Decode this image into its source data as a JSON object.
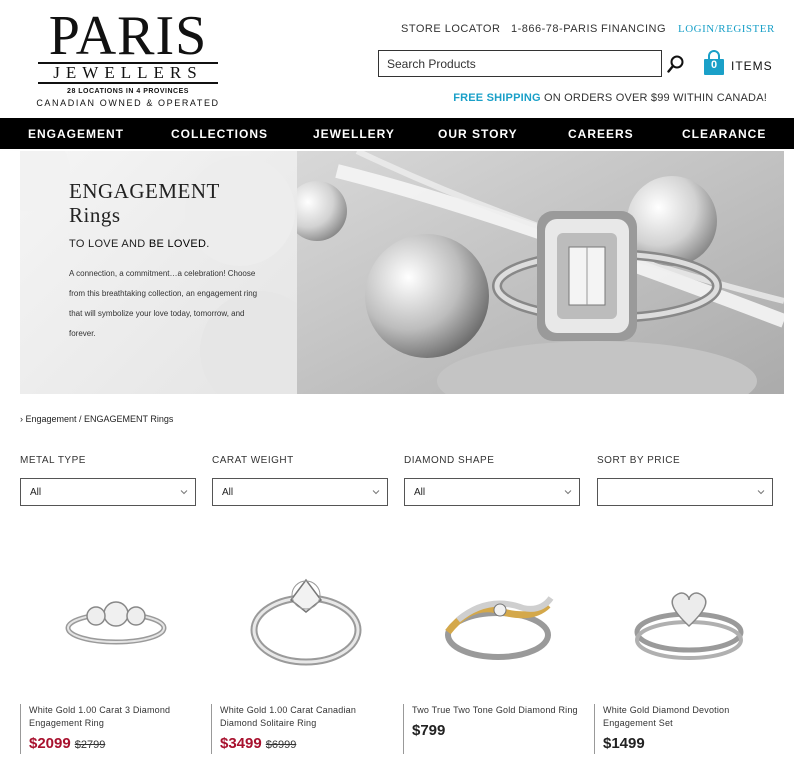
{
  "brand": {
    "name": "PARIS",
    "sub": "JEWELLERS",
    "locations": "28 LOCATIONS IN 4 PROVINCES",
    "tagline": "CANADIAN OWNED & OPERATED"
  },
  "toplinks": {
    "store_locator": "STORE LOCATOR",
    "phone": "1-866-78-PARIS",
    "financing": "FINANCING",
    "login": "LOGIN/REGISTER"
  },
  "search": {
    "placeholder": "Search Products"
  },
  "cart": {
    "count": "0",
    "label": "ITEMS"
  },
  "shipping": {
    "highlight": "FREE SHIPPING",
    "rest": " ON ORDERS OVER $99 WITHIN CANADA!"
  },
  "nav": [
    "ENGAGEMENT",
    "COLLECTIONS",
    "JEWELLERY",
    "OUR STORY",
    "CAREERS",
    "CLEARANCE"
  ],
  "hero": {
    "title_line1": "ENGAGEMENT",
    "title_line2": "Rings",
    "sub_plain": "TO LOVE AND ",
    "sub_bold": "BE LOVED",
    "sub_end": ".",
    "desc": "A connection, a commitment…a celebration! Choose from this breathtaking collection, an engagement ring that will symbolize your love today, tomorrow, and forever."
  },
  "breadcrumb": "› Engagement / ENGAGEMENT Rings",
  "filters": [
    {
      "label": "METAL TYPE",
      "value": "All"
    },
    {
      "label": "CARAT WEIGHT",
      "value": "All"
    },
    {
      "label": "DIAMOND SHAPE",
      "value": "All"
    },
    {
      "label": "SORT BY PRICE",
      "value": ""
    }
  ],
  "products": [
    {
      "name": "White Gold 1.00 Carat 3 Diamond Engagement Ring",
      "price": "$2099",
      "old_price": "$2799",
      "sale": true
    },
    {
      "name": "White Gold 1.00 Carat Canadian Diamond Solitaire Ring",
      "price": "$3499",
      "old_price": "$6999",
      "sale": true
    },
    {
      "name": "Two True Two Tone Gold Diamond Ring",
      "price": "$799",
      "old_price": "",
      "sale": false
    },
    {
      "name": "White Gold Diamond Devotion Engagement Set",
      "price": "$1499",
      "old_price": "",
      "sale": false
    }
  ],
  "colors": {
    "accent": "#1aa0c8",
    "sale": "#a8112e",
    "nav_bg": "#000000"
  }
}
